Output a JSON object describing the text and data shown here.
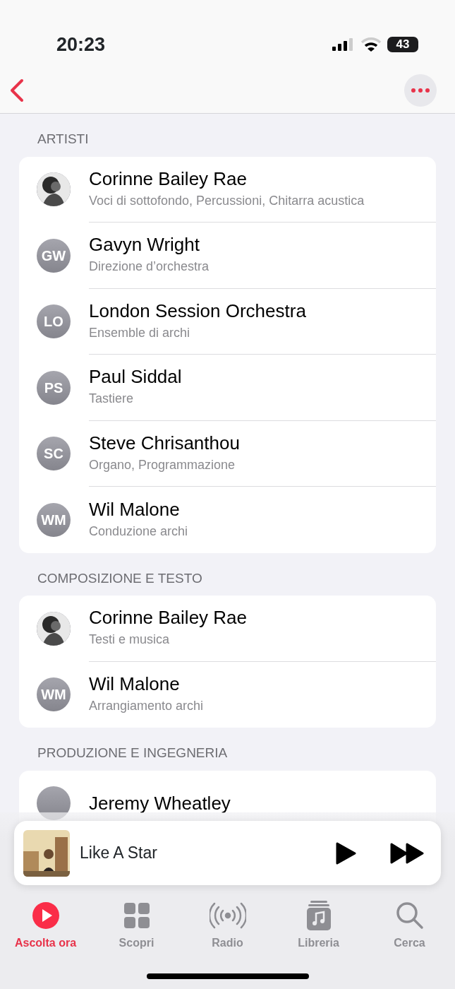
{
  "status_bar": {
    "time": "20:23",
    "battery": "43"
  },
  "sections": [
    {
      "title": "ARTISTI",
      "people": [
        {
          "name": "Corinne Bailey Rae",
          "role": "Voci di sottofondo, Percussioni, Chitarra acustica"
        },
        {
          "name": "Gavyn Wright",
          "role": "Direzione d’orchestra",
          "kind": "initials",
          "initials": "GW"
        },
        {
          "name": "London Session Orchestra",
          "role": "Ensemble di archi",
          "kind": "initials",
          "initials": "LO"
        },
        {
          "name": "Paul Siddal",
          "role": "Tastiere",
          "kind": "initials",
          "initials": "PS"
        },
        {
          "name": "Steve Chrisanthou",
          "role": "Organo, Programmazione",
          "kind": "initials",
          "initials": "SC"
        },
        {
          "name": "Wil Malone",
          "role": "Conduzione archi",
          "kind": "initials",
          "initials": "WM"
        }
      ]
    },
    {
      "title": "COMPOSIZIONE E TESTO",
      "people": [
        {
          "name": "Corinne Bailey Rae",
          "role": "Testi e musica"
        },
        {
          "name": "Wil Malone",
          "role": "Arrangiamento archi",
          "kind": "initials",
          "initials": "WM"
        }
      ]
    },
    {
      "title": "PRODUZIONE E INGEGNERIA",
      "people": [
        {
          "name": "Jeremy Wheatley",
          "kind": "initials"
        }
      ]
    }
  ],
  "mini_player": {
    "title": "Like A Star"
  },
  "tabs": [
    {
      "label": "Ascolta ora",
      "kind": "play",
      "selected": true
    },
    {
      "label": "Scopri",
      "kind": "grid",
      "selected": false
    },
    {
      "label": "Radio",
      "kind": "radio",
      "selected": false
    },
    {
      "label": "Libreria",
      "kind": "library",
      "selected": false
    },
    {
      "label": "Cerca",
      "kind": "search",
      "selected": false
    }
  ]
}
